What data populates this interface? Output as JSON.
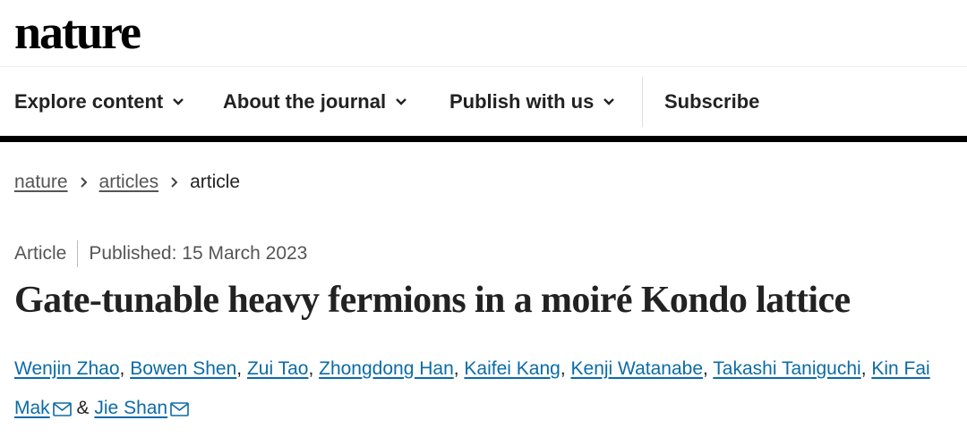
{
  "brand": {
    "logo": "nature"
  },
  "nav": {
    "items": [
      {
        "label": "Explore content",
        "icon": "chevron-down-icon"
      },
      {
        "label": "About the journal",
        "icon": "chevron-down-icon"
      },
      {
        "label": "Publish with us",
        "icon": "chevron-down-icon"
      }
    ],
    "subscribe": "Subscribe"
  },
  "breadcrumb": {
    "items": [
      "nature",
      "articles"
    ],
    "current": "article"
  },
  "article": {
    "type": "Article",
    "published": "Published: 15 March 2023",
    "title": "Gate-tunable heavy fermions in a moiré Kondo lattice",
    "authors": [
      "Wenjin Zhao",
      "Bowen Shen",
      "Zui Tao",
      "Zhongdong Han",
      "Kaifei Kang",
      "Kenji Watanabe",
      "Takashi Taniguchi",
      "Kin Fai Mak",
      "Jie Shan"
    ],
    "conjunction": "&"
  },
  "colors": {
    "link": "#0b6ba8",
    "text": "#222222",
    "muted": "#555555",
    "rule": "#000000"
  }
}
